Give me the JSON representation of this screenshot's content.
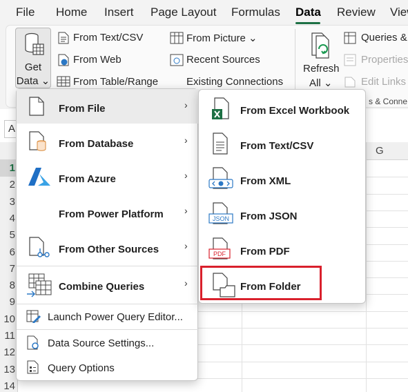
{
  "menubar": {
    "tabs": [
      {
        "label": "File",
        "active": false
      },
      {
        "label": "Home",
        "active": false
      },
      {
        "label": "Insert",
        "active": false
      },
      {
        "label": "Page Layout",
        "active": false
      },
      {
        "label": "Formulas",
        "active": false
      },
      {
        "label": "Data",
        "active": true
      },
      {
        "label": "Review",
        "active": false
      },
      {
        "label": "View",
        "active": false
      }
    ],
    "accent": "#1d7044"
  },
  "ribbon": {
    "get_data": {
      "line1": "Get",
      "line2": "Data ⌄"
    },
    "get_transform": [
      {
        "label": "From Text/CSV",
        "icon": "text-csv-icon"
      },
      {
        "label": "From Web",
        "icon": "globe-icon"
      },
      {
        "label": "From Table/Range",
        "icon": "table-icon"
      }
    ],
    "get_transform2": [
      {
        "label": "From Picture ⌄",
        "icon": "picture-icon"
      },
      {
        "label": "Recent Sources",
        "icon": "recent-icon"
      },
      {
        "label": "Existing Connections",
        "icon": "connections-icon"
      }
    ],
    "refresh": {
      "line1": "Refresh",
      "line2": "All ⌄"
    },
    "queries": [
      {
        "label": "Queries &",
        "dim": false
      },
      {
        "label": "Properties",
        "dim": true
      },
      {
        "label": "Edit Links",
        "dim": true
      }
    ],
    "group_label": "s & Conne"
  },
  "grid": {
    "name_box": "A",
    "rows": [
      "1",
      "2",
      "3",
      "4",
      "5",
      "6",
      "7",
      "8",
      "9",
      "10",
      "11",
      "12",
      "13",
      "14"
    ],
    "selected_row": "1",
    "col_g": "G"
  },
  "get_data_menu": {
    "items": [
      {
        "label": "From File",
        "icon": "file-icon",
        "submenu": true
      },
      {
        "label": "From Database",
        "icon": "database-icon",
        "submenu": true
      },
      {
        "label": "From Azure",
        "icon": "azure-icon",
        "submenu": true
      },
      {
        "label": "From Power Platform",
        "icon": "",
        "submenu": true
      },
      {
        "label": "From Other Sources",
        "icon": "other-sources-icon",
        "submenu": true
      },
      {
        "label": "Combine Queries",
        "icon": "combine-queries-icon",
        "submenu": true
      },
      {
        "label": "Launch Power Query Editor...",
        "icon": "power-query-editor-icon",
        "submenu": false
      },
      {
        "label": "Data Source Settings...",
        "icon": "data-source-settings-icon",
        "submenu": false
      },
      {
        "label": "Query Options",
        "icon": "query-options-icon",
        "submenu": false
      }
    ]
  },
  "from_file_submenu": {
    "items": [
      {
        "label": "From Excel Workbook",
        "icon": "excel-workbook-icon"
      },
      {
        "label": "From Text/CSV",
        "icon": "text-file-icon"
      },
      {
        "label": "From XML",
        "icon": "xml-icon"
      },
      {
        "label": "From JSON",
        "icon": "json-icon"
      },
      {
        "label": "From PDF",
        "icon": "pdf-icon"
      },
      {
        "label": "From Folder",
        "icon": "folder-icon"
      }
    ],
    "highlighted": "From Folder",
    "highlight_color": "#d9202c"
  },
  "icons": {
    "arrow": "›"
  }
}
